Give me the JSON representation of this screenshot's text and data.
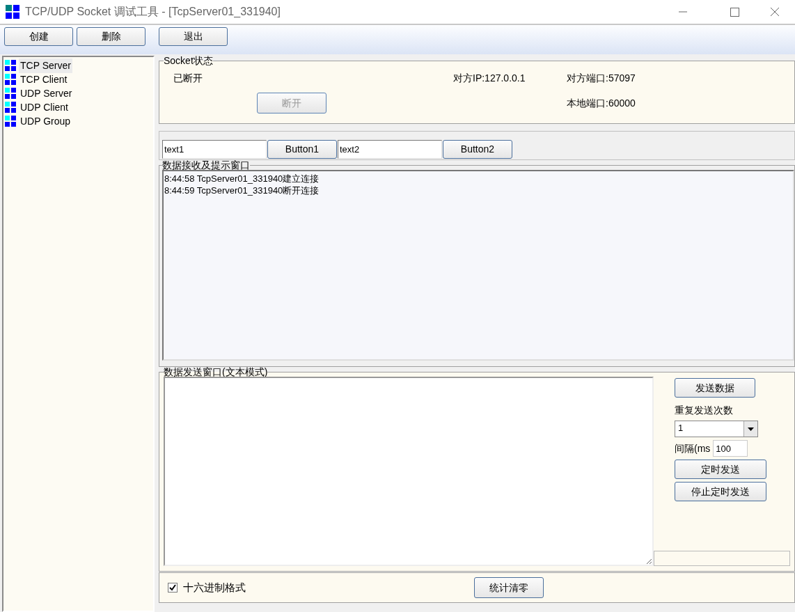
{
  "window": {
    "title": "TCP/UDP Socket 调试工具 - [TcpServer01_331940]"
  },
  "toolbar": {
    "buttons": [
      "创建",
      "删除",
      "退出"
    ]
  },
  "tree": {
    "items": [
      {
        "label": "TCP Server",
        "selected": true
      },
      {
        "label": "TCP Client",
        "selected": false
      },
      {
        "label": "UDP Server",
        "selected": false
      },
      {
        "label": "UDP Client",
        "selected": false
      },
      {
        "label": "UDP Group",
        "selected": false
      }
    ]
  },
  "socket_status": {
    "title": "Socket状态",
    "state": "已断开",
    "remote_ip": "对方IP:127.0.0.1",
    "remote_port": "对方端口:57097",
    "local_port": "本地端口:60000",
    "disconnect_button": {
      "label": "断开",
      "disabled": true
    }
  },
  "test_bar": {
    "fields": [
      {
        "value": "text1",
        "button": "Button1"
      },
      {
        "value": "text2",
        "button": "Button2"
      }
    ]
  },
  "receive": {
    "title": "数据接收及提示窗口",
    "lines": [
      "8:44:58 TcpServer01_331940建立连接",
      "8:44:59 TcpServer01_331940断开连接"
    ]
  },
  "send": {
    "title": "数据发送窗口(文本模式)",
    "send_button": "发送数据",
    "repeat_label": "重复发送次数",
    "repeat_value": "1",
    "interval_label": "间隔(ms",
    "interval_value": "100",
    "timer_button": "定时发送",
    "stop_timer_button": "停止定时发送"
  },
  "footer": {
    "hex": {
      "label": "十六进制格式",
      "checked": true
    },
    "reset_button": "统计清零"
  }
}
